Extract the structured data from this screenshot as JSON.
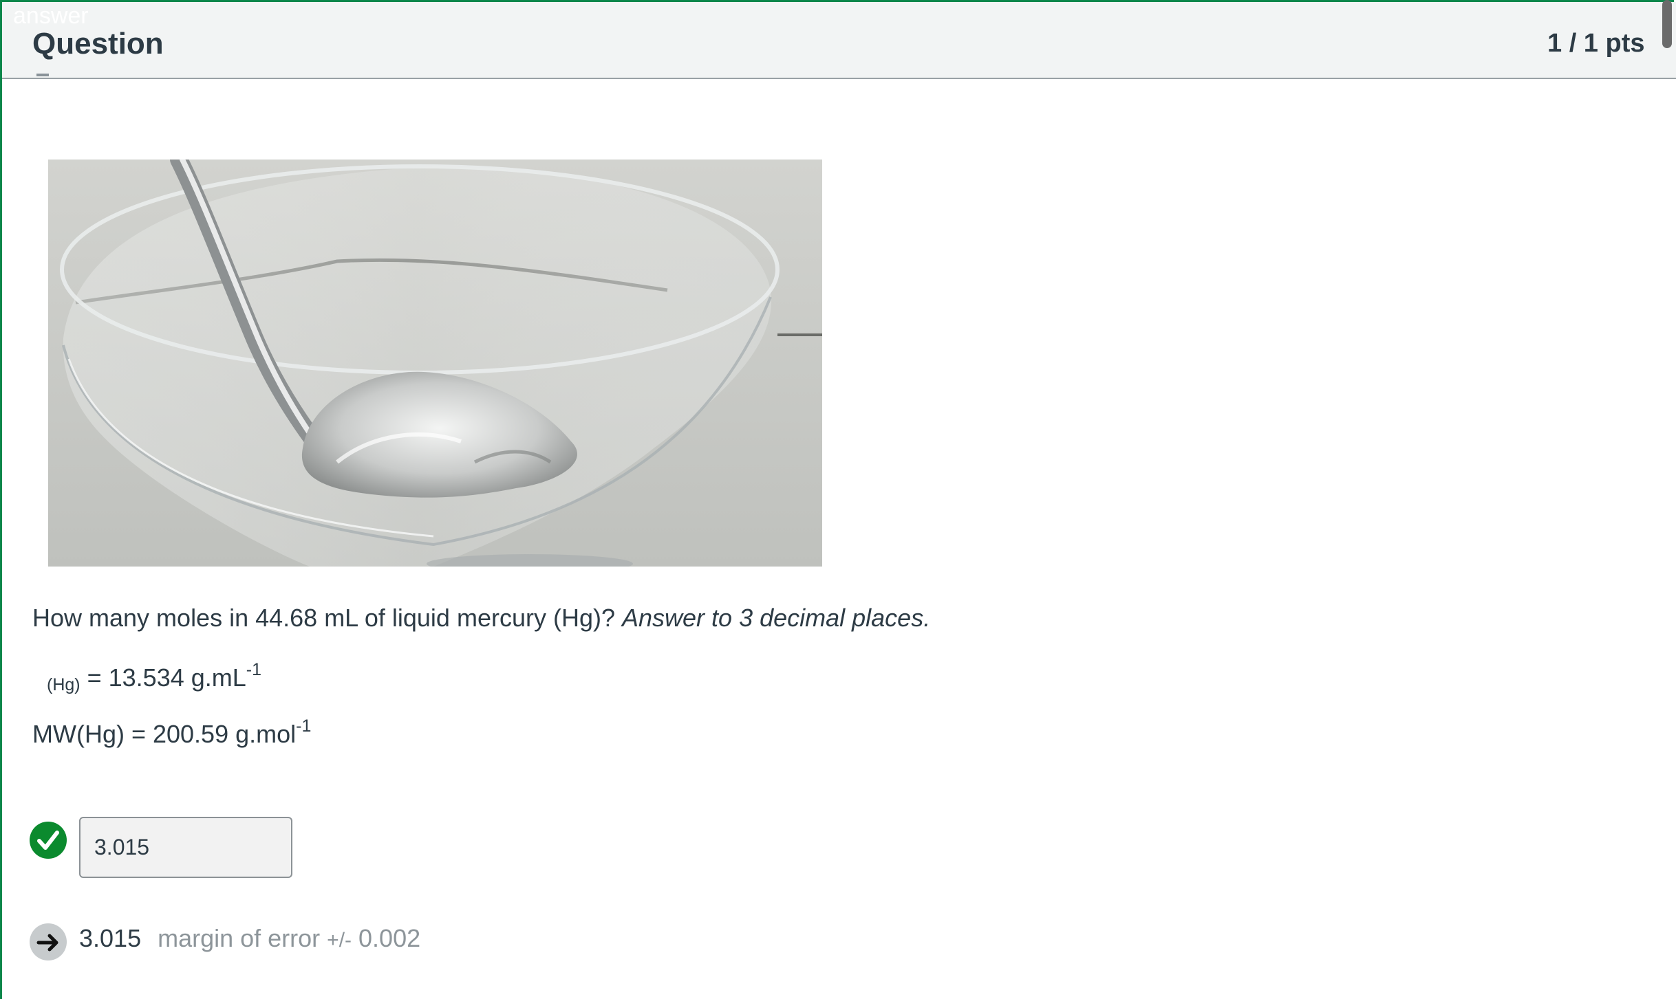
{
  "header": {
    "ghost_label": "answer",
    "title": "Question",
    "points": "1 / 1 pts"
  },
  "question": {
    "text_main": "How many moles in 44.68 mL of liquid mercury (Hg)? ",
    "text_italic": "Answer to 3 decimal places.",
    "density": {
      "subscript": "(Hg)",
      "value": " = 13.534 g.mL",
      "superscript": "-1"
    },
    "molar_mass": {
      "value": "MW(Hg) = 200.59 g.mol",
      "superscript": "-1"
    }
  },
  "answer": {
    "user_value": "3.015",
    "status": "correct",
    "correct_value": "3.015",
    "margin_label": "margin of error ",
    "margin_symbol": "+/-",
    "margin_value": " 0.002"
  },
  "icons": {
    "check": "check-circle-icon",
    "arrow": "arrow-right-circle-icon"
  },
  "colors": {
    "correct_green": "#0b8a2e",
    "frame_green": "#0b874b",
    "header_bg": "#f2f4f4",
    "muted_text": "#8d959a"
  }
}
